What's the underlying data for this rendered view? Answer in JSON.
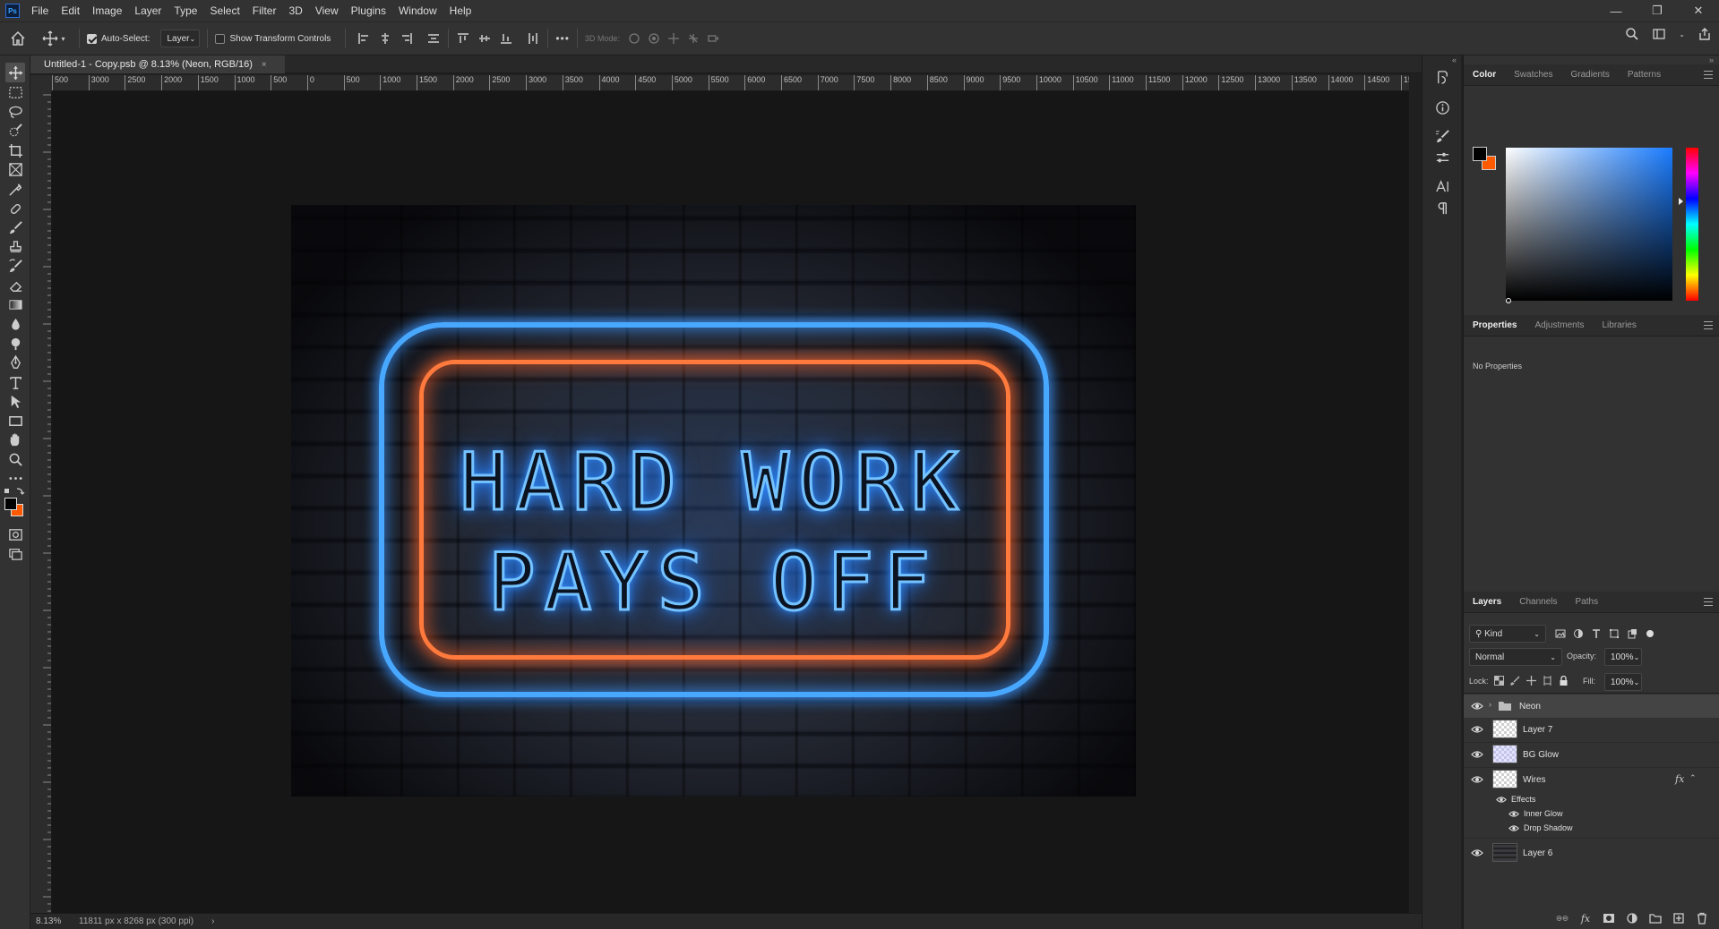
{
  "menu": [
    "File",
    "Edit",
    "Image",
    "Layer",
    "Type",
    "Select",
    "Filter",
    "3D",
    "View",
    "Plugins",
    "Window",
    "Help"
  ],
  "options_bar": {
    "auto_select_label": "Auto-Select:",
    "auto_select_target": "Layer",
    "transform_controls_label": "Show Transform Controls",
    "more": "•••",
    "mode_3d_label": "3D Mode:"
  },
  "document": {
    "tab_title": "Untitled-1 - Copy.psb @ 8.13% (Neon, RGB/16)",
    "close": "×"
  },
  "ruler": {
    "h_labels": [
      "500",
      "3000",
      "2500",
      "2000",
      "1500",
      "1000",
      "500",
      "0",
      "500",
      "1000",
      "1500",
      "2000",
      "2500",
      "3000",
      "3500",
      "4000",
      "4500",
      "5000",
      "5500",
      "6000",
      "6500",
      "7000",
      "7500",
      "8000",
      "8500",
      "9000",
      "9500",
      "10000",
      "10500",
      "11000",
      "11500",
      "12000",
      "12500",
      "13000",
      "13500",
      "14000",
      "14500",
      "150"
    ]
  },
  "canvas": {
    "line1": "HARD WORK",
    "line2": "PAYS OFF"
  },
  "status": {
    "zoom": "8.13%",
    "doc_size": "11811 px x 8268 px (300 ppi)",
    "arrow": "›"
  },
  "color_panel": {
    "tabs": [
      "Color",
      "Swatches",
      "Gradients",
      "Patterns"
    ],
    "foreground": "#000000",
    "background": "#ff5a00"
  },
  "properties_panel": {
    "tabs": [
      "Properties",
      "Adjustments",
      "Libraries"
    ],
    "message": "No Properties"
  },
  "layers_panel": {
    "tabs": [
      "Layers",
      "Channels",
      "Paths"
    ],
    "filter_kind": "Kind",
    "blend_mode": "Normal",
    "opacity_label": "Opacity:",
    "opacity_value": "100%",
    "lock_label": "Lock:",
    "fill_label": "Fill:",
    "fill_value": "100%",
    "layers": [
      {
        "name": "Neon",
        "type": "group",
        "selected": true
      },
      {
        "name": "Layer 7",
        "type": "pixel"
      },
      {
        "name": "BG Glow",
        "type": "pixel"
      },
      {
        "name": "Wires",
        "type": "pixel",
        "fx": "fx"
      },
      {
        "name": "Layer 6",
        "type": "pixel"
      }
    ],
    "effects_label": "Effects",
    "effects": [
      "Inner Glow",
      "Drop Shadow"
    ]
  },
  "colors": {
    "accent_blue": "#48a8ff",
    "accent_orange": "#ff7a3c"
  }
}
